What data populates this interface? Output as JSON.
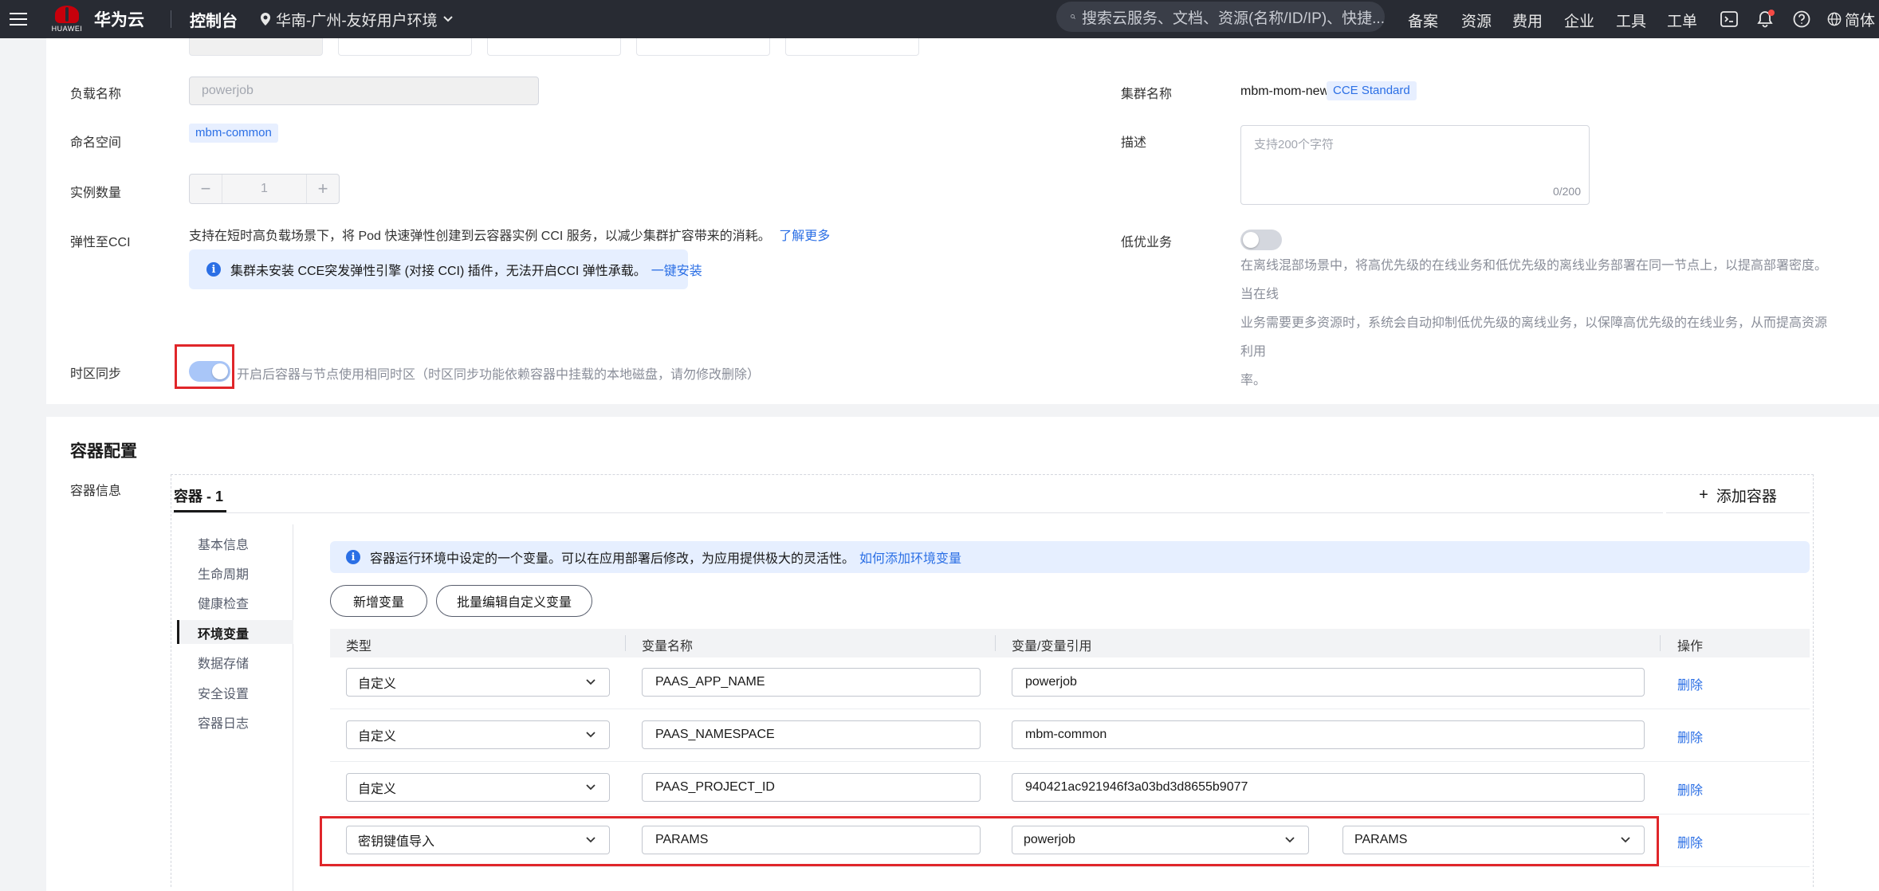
{
  "topbar": {
    "logo_text": "HUAWEI",
    "brand": "华为云",
    "console": "控制台",
    "region": "华南-广州-友好用户环境",
    "search_placeholder": "搜索云服务、文档、资源(名称/ID/IP)、快捷...",
    "nav": [
      "备案",
      "资源",
      "费用",
      "企业",
      "工具",
      "工单"
    ],
    "language": "简体"
  },
  "basic": {
    "workload_label": "负载名称",
    "workload_value": "powerjob",
    "namespace_label": "命名空间",
    "namespace_value": "mbm-common",
    "instances_label": "实例数量",
    "instances_value": "1",
    "cci_label": "弹性至CCI",
    "cci_desc": "支持在短时高负载场景下，将 Pod 快速弹性创建到云容器实例 CCI 服务，以减少集群扩容带来的消耗。",
    "cci_learn_more": "了解更多",
    "cci_notice": "集群未安装 CCE突发弹性引擎 (对接 CCI) 插件，无法开启CCI 弹性承载。",
    "cci_install": "一键安装",
    "tz_label": "时区同步",
    "tz_enabled": true,
    "tz_desc": "开启后容器与节点使用相同时区（时区同步功能依赖容器中挂载的本地磁盘，请勿修改删除）",
    "cluster_label": "集群名称",
    "cluster_value": "mbm-mom-new",
    "cluster_tag": "CCE Standard",
    "desc_label": "描述",
    "desc_placeholder": "支持200个字符",
    "desc_count": "0/200",
    "lowprio_label": "低优业务",
    "lowprio_enabled": false,
    "lowprio_desc": [
      "在离线混部场景中，将高优先级的在线业务和低优先级的离线业务部署在同一节点上，以提高部署密度。当在线",
      "业务需要更多资源时，系统会自动抑制低优先级的离线业务，以保障高优先级的在线业务，从而提高资源利用",
      "率。"
    ]
  },
  "container": {
    "section_title": "容器配置",
    "info_label": "容器信息",
    "tab": "容器 - 1",
    "add_container": "添加容器",
    "subnav": [
      "基本信息",
      "生命周期",
      "健康检查",
      "环境变量",
      "数据存储",
      "安全设置",
      "容器日志"
    ],
    "active_subnav": "环境变量",
    "env_notice": "容器运行环境中设定的一个变量。可以在应用部署后修改，为应用提供极大的灵活性。",
    "env_notice_link": "如何添加环境变量",
    "btn_add": "新增变量",
    "btn_batch": "批量编辑自定义变量",
    "columns": [
      "类型",
      "变量名称",
      "变量/变量引用",
      "操作"
    ],
    "rows": [
      {
        "type": "自定义",
        "name": "PAAS_APP_NAME",
        "value": "powerjob",
        "action": "删除"
      },
      {
        "type": "自定义",
        "name": "PAAS_NAMESPACE",
        "value": "mbm-common",
        "action": "删除"
      },
      {
        "type": "自定义",
        "name": "PAAS_PROJECT_ID",
        "value": "940421ac921946f3a03bd3d8655b9077",
        "action": "删除"
      },
      {
        "type": "密钥键值导入",
        "name": "PARAMS",
        "secret": "powerjob",
        "key": "PARAMS",
        "action": "删除"
      }
    ]
  },
  "colors": {
    "topbar": "#282b33",
    "link": "#2b6fe5",
    "highlight": "#e0262a"
  }
}
